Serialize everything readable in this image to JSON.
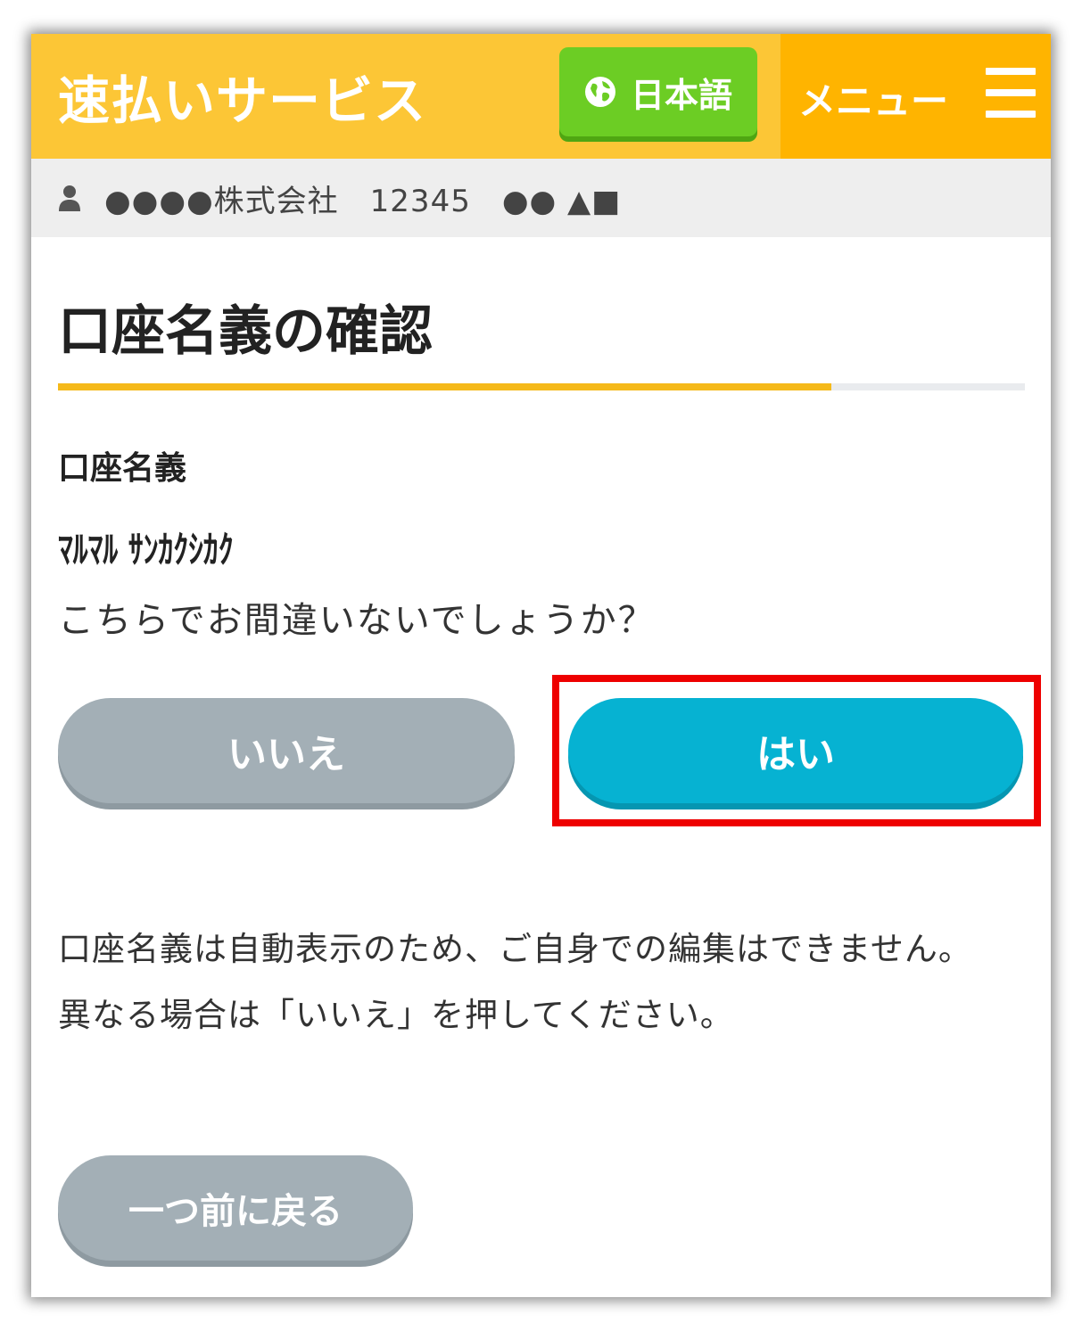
{
  "header": {
    "brand": "速払いサービス",
    "language_label": "日本語",
    "menu_label": "メニュー",
    "icons": {
      "language": "globe-icon",
      "menu": "hamburger-menu-icon"
    },
    "colors": {
      "header_bg": "#fcc636",
      "menu_bg": "#ffb400",
      "language_button": "#6ccd24"
    }
  },
  "account_bar": {
    "icon": "user-icon",
    "text": "●●●●株式会社　12345　●● ▲■"
  },
  "main": {
    "title": "口座名義の確認",
    "progress_percent": 80,
    "field_label": "口座名義",
    "account_holder": "ﾏﾙﾏﾙ ｻﾝｶｸｼｶｸ",
    "question": "こちらでお間違いないでしょうか？",
    "buttons": {
      "no_label": "いいえ",
      "yes_label": "はい",
      "back_label": "一つ前に戻る"
    },
    "notes": [
      "口座名義は自動表示のため、ご自身での編集はできません。",
      "異なる場合は「いいえ」を押してください。"
    ],
    "colors": {
      "yes_button": "#06b2d2",
      "no_button": "#a3afb6",
      "progress": "#f5b91a",
      "highlight": "#ee0000"
    }
  }
}
